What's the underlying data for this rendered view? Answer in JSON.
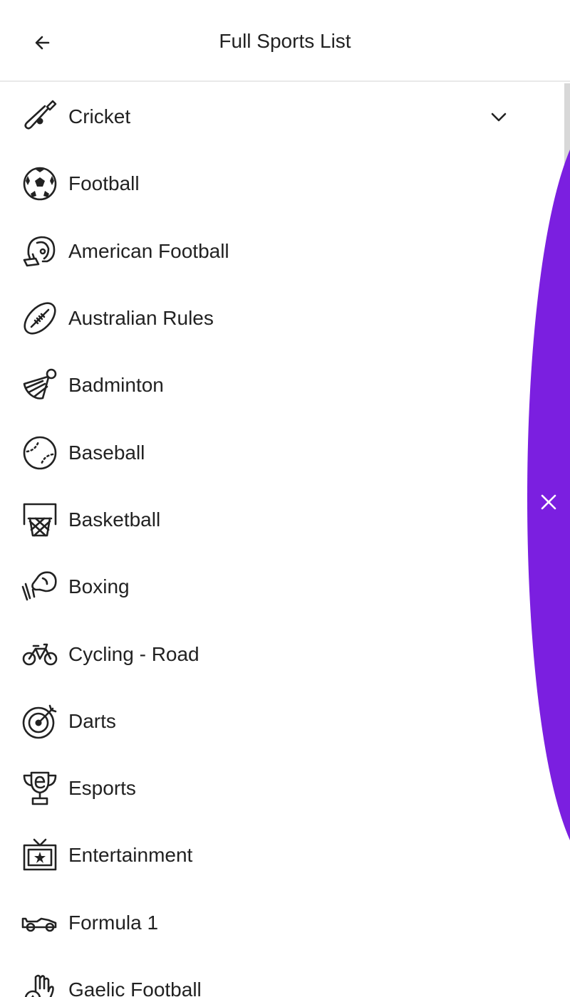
{
  "header": {
    "title": "Full Sports List"
  },
  "sports": [
    {
      "label": "Cricket",
      "icon": "cricket-bat-icon",
      "expandable": true
    },
    {
      "label": "Football",
      "icon": "football-icon"
    },
    {
      "label": "American Football",
      "icon": "american-football-helmet-icon"
    },
    {
      "label": "Australian Rules",
      "icon": "australian-rules-ball-icon"
    },
    {
      "label": "Badminton",
      "icon": "shuttlecock-icon"
    },
    {
      "label": "Baseball",
      "icon": "baseball-icon"
    },
    {
      "label": "Basketball",
      "icon": "basketball-hoop-icon"
    },
    {
      "label": "Boxing",
      "icon": "boxing-glove-icon"
    },
    {
      "label": "Cycling - Road",
      "icon": "bicycle-icon"
    },
    {
      "label": "Darts",
      "icon": "dartboard-icon"
    },
    {
      "label": "Esports",
      "icon": "esports-trophy-icon"
    },
    {
      "label": "Entertainment",
      "icon": "tv-star-icon"
    },
    {
      "label": "Formula 1",
      "icon": "race-car-icon"
    },
    {
      "label": "Gaelic Football",
      "icon": "gaelic-football-icon"
    }
  ],
  "colors": {
    "overlay": "#7b1fe0",
    "text": "#222222",
    "divider": "#e9e9e9"
  }
}
